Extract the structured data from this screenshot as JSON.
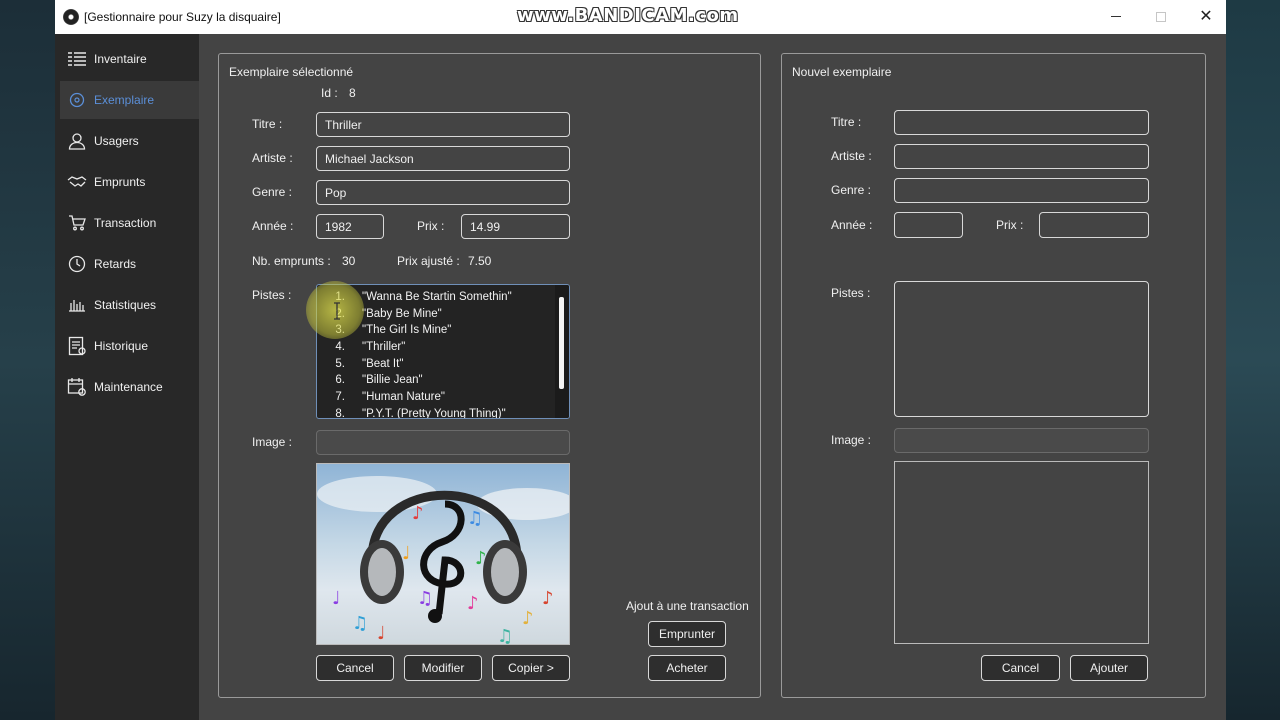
{
  "window": {
    "title": "[Gestionnaire pour Suzy la disquaire]",
    "watermark": "www.BANDICAM.com",
    "close_glyph": "✕"
  },
  "sidebar": {
    "items": [
      {
        "label": "Inventaire",
        "icon": "list-icon",
        "active": false
      },
      {
        "label": "Exemplaire",
        "icon": "disc-icon",
        "active": true
      },
      {
        "label": "Usagers",
        "icon": "user-icon",
        "active": false
      },
      {
        "label": "Emprunts",
        "icon": "handshake-icon",
        "active": false
      },
      {
        "label": "Transaction",
        "icon": "cart-icon",
        "active": false
      },
      {
        "label": "Retards",
        "icon": "clock-icon",
        "active": false
      },
      {
        "label": "Statistiques",
        "icon": "bar-chart-icon",
        "active": false
      },
      {
        "label": "Historique",
        "icon": "history-icon",
        "active": false
      },
      {
        "label": "Maintenance",
        "icon": "calendar-gear-icon",
        "active": false
      }
    ],
    "active_color": "#5b8fd8"
  },
  "selected": {
    "title": "Exemplaire sélectionné",
    "id_label": "Id :",
    "id_value": "8",
    "titre_label": "Titre :",
    "titre_value": "Thriller",
    "artiste_label": "Artiste :",
    "artiste_value": "Michael Jackson",
    "genre_label": "Genre :",
    "genre_value": "Pop",
    "annee_label": "Année :",
    "annee_value": "1982",
    "prix_label": "Prix :",
    "prix_value": "14.99",
    "emprunts_label": "Nb. emprunts :",
    "emprunts_value": "30",
    "prix_ajuste_label": "Prix ajusté :",
    "prix_ajuste_value": "7.50",
    "pistes_label": "Pistes :",
    "tracks": [
      {
        "n": "1.",
        "title": "\"Wanna Be Startin Somethin\""
      },
      {
        "n": "2.",
        "title": "\"Baby Be Mine\""
      },
      {
        "n": "3.",
        "title": "\"The Girl Is Mine\""
      },
      {
        "n": "4.",
        "title": "\"Thriller\""
      },
      {
        "n": "5.",
        "title": "\"Beat It\""
      },
      {
        "n": "6.",
        "title": "\"Billie Jean\""
      },
      {
        "n": "7.",
        "title": "\"Human Nature\""
      },
      {
        "n": "8.",
        "title": "\"P.Y.T. (Pretty Young Thing)\""
      }
    ],
    "image_label": "Image :",
    "image_value": "",
    "buttons": {
      "cancel": "Cancel",
      "modify": "Modifier",
      "copy": "Copier >"
    }
  },
  "transaction": {
    "title": "Ajout à une transaction",
    "borrow": "Emprunter",
    "buy": "Acheter"
  },
  "new_item": {
    "title": "Nouvel exemplaire",
    "titre_label": "Titre :",
    "artiste_label": "Artiste :",
    "genre_label": "Genre :",
    "annee_label": "Année :",
    "prix_label": "Prix :",
    "pistes_label": "Pistes :",
    "image_label": "Image :",
    "buttons": {
      "cancel": "Cancel",
      "add": "Ajouter"
    }
  },
  "colors": {
    "window_bg": "#444444",
    "sidebar_bg": "#282828",
    "border": "#d8d8d8"
  }
}
